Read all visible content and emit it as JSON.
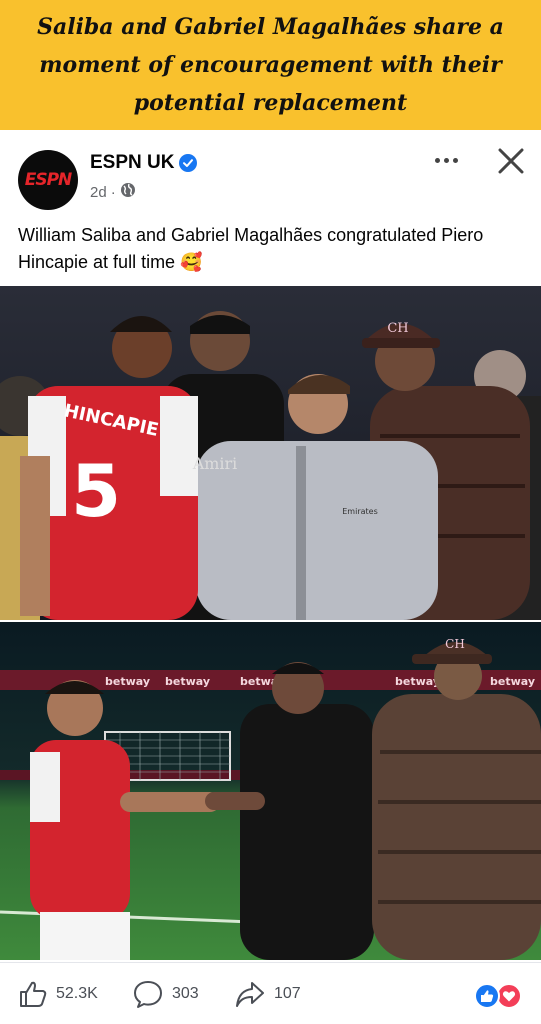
{
  "banner": {
    "headline": "Saliba and Gabriel Magalhães share a moment of encouragement with their potential replacement"
  },
  "post": {
    "page_name": "ESPN UK",
    "avatar_text": "ESPN",
    "time": "2d",
    "separator": "·",
    "audience_icon": "globe-icon",
    "verified_icon": "verified-badge-icon",
    "caption": "William Saliba and Gabriel Magalhães congratulated Piero Hincapie at full time 🥰",
    "photo_top": {
      "jersey_name": "HINCAPIE",
      "jersey_number": "5",
      "hoodie_text": "Amiri",
      "sponsor_text": "Emirates",
      "cap_text": "CH"
    },
    "photo_bottom": {
      "board_texts": [
        "betway",
        "betway",
        "betway",
        "betway",
        "betway"
      ],
      "cap_text": "CH"
    }
  },
  "actions": {
    "like_count": "52.3K",
    "comment_count": "303",
    "share_count": "107"
  },
  "colors": {
    "banner_bg": "#f9c12d",
    "verified_blue": "#1877f2",
    "like_blue": "#1877f2",
    "love_red": "#f33e58",
    "espn_red": "#e5252a"
  }
}
